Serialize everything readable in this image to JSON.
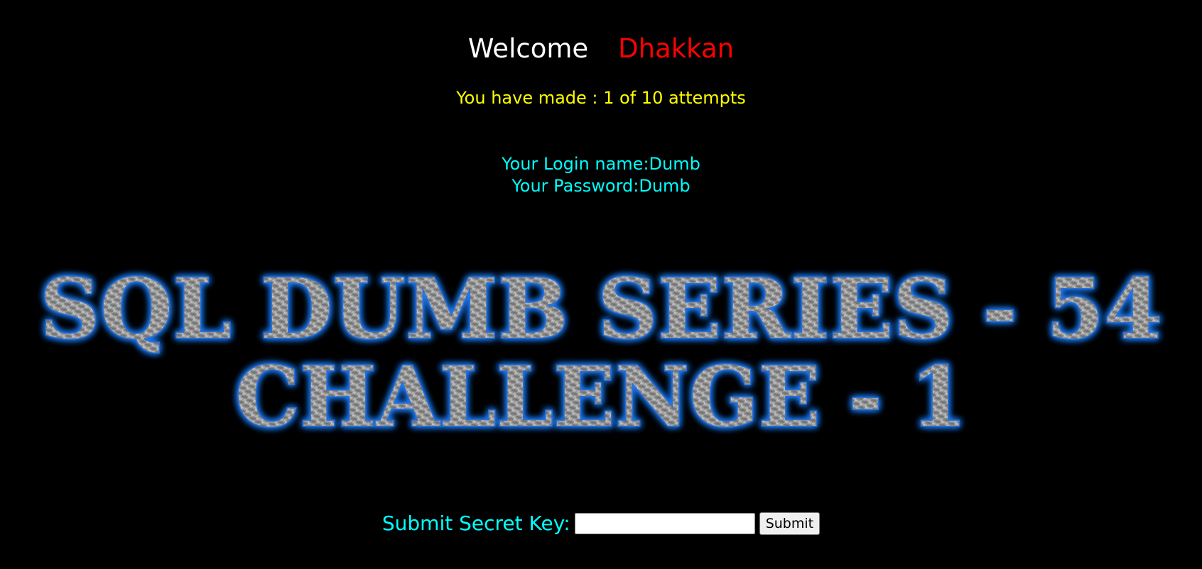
{
  "welcome": {
    "greeting": "Welcome",
    "name": "Dhakkan"
  },
  "attempts": {
    "text": "You have made : 1 of 10 attempts"
  },
  "credentials": {
    "login_line": "Your Login name:Dumb",
    "password_line": "Your Password:Dumb"
  },
  "banner": {
    "line1": "SQL DUMB SERIES - 54",
    "line2": "CHALLENGE - 1"
  },
  "form": {
    "label": "Submit Secret Key:",
    "input_value": "",
    "button_label": "Submit"
  },
  "colors": {
    "background": "#000000",
    "name": "#ff0000",
    "attempts": "#ffff00",
    "credentials": "#00ffff",
    "banner_glow": "#1e7fff"
  }
}
